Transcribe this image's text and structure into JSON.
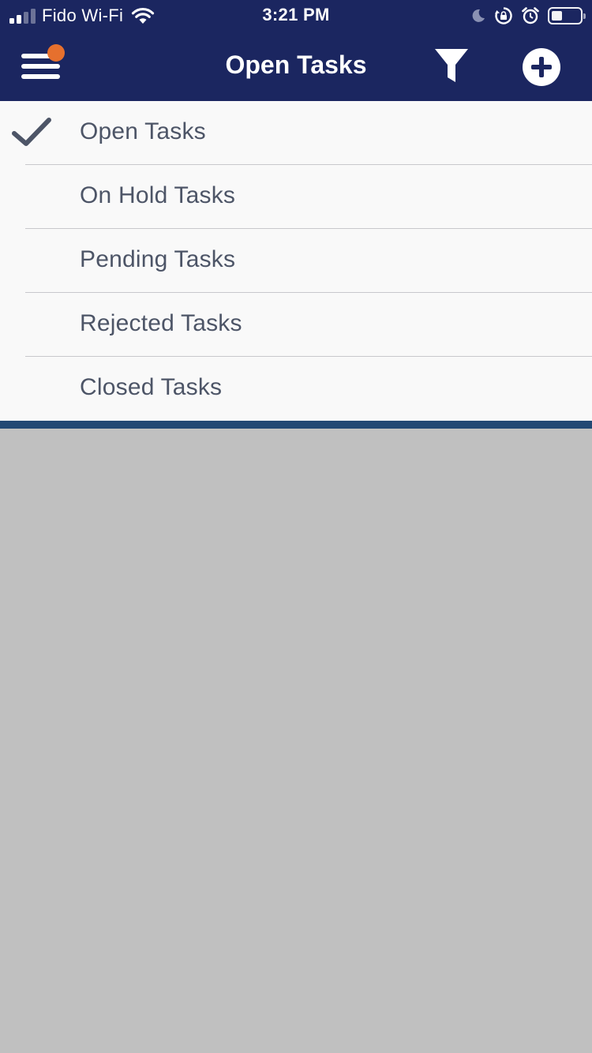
{
  "status_bar": {
    "carrier": "Fido Wi-Fi",
    "time": "3:21 PM"
  },
  "nav": {
    "title": "Open Tasks",
    "has_notification": true,
    "notification_color": "#e6702e",
    "bar_color": "#1b2660"
  },
  "task_filter": {
    "selected": "Open Tasks",
    "items": [
      {
        "label": "Open Tasks",
        "selected": true
      },
      {
        "label": "On Hold Tasks",
        "selected": false
      },
      {
        "label": "Pending Tasks",
        "selected": false
      },
      {
        "label": "Rejected Tasks",
        "selected": false
      },
      {
        "label": "Closed Tasks",
        "selected": false
      }
    ]
  },
  "icons": [
    "menu-icon",
    "filter-icon",
    "add-icon",
    "checkmark-icon",
    "wifi-icon",
    "moon-icon",
    "rotation-lock-icon",
    "alarm-icon",
    "battery-icon"
  ]
}
